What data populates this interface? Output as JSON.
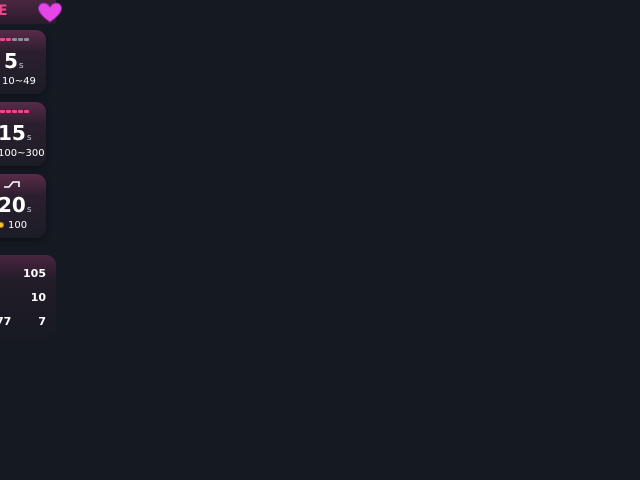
{
  "header": {
    "glyph": "E",
    "heart_icon": "heart-icon"
  },
  "cards": [
    {
      "value": "5",
      "unit": "s",
      "range": "10~49",
      "rate_icon": "dash-meter"
    },
    {
      "value": "15",
      "unit": "s",
      "range": "100~300",
      "rate_icon": "dash-meter"
    },
    {
      "value": "20",
      "unit": "s",
      "range": "100",
      "rate_icon": "step-arrow-icon",
      "range_icon": "coin-icon"
    }
  ],
  "stats": {
    "row1_right": "105",
    "row2_right": "10",
    "row3_left": "77",
    "row3_right": "7"
  },
  "colors": {
    "background": "#151922",
    "accent": "#f0468e",
    "heart": "#e646e6",
    "coin": "#f4c233"
  }
}
